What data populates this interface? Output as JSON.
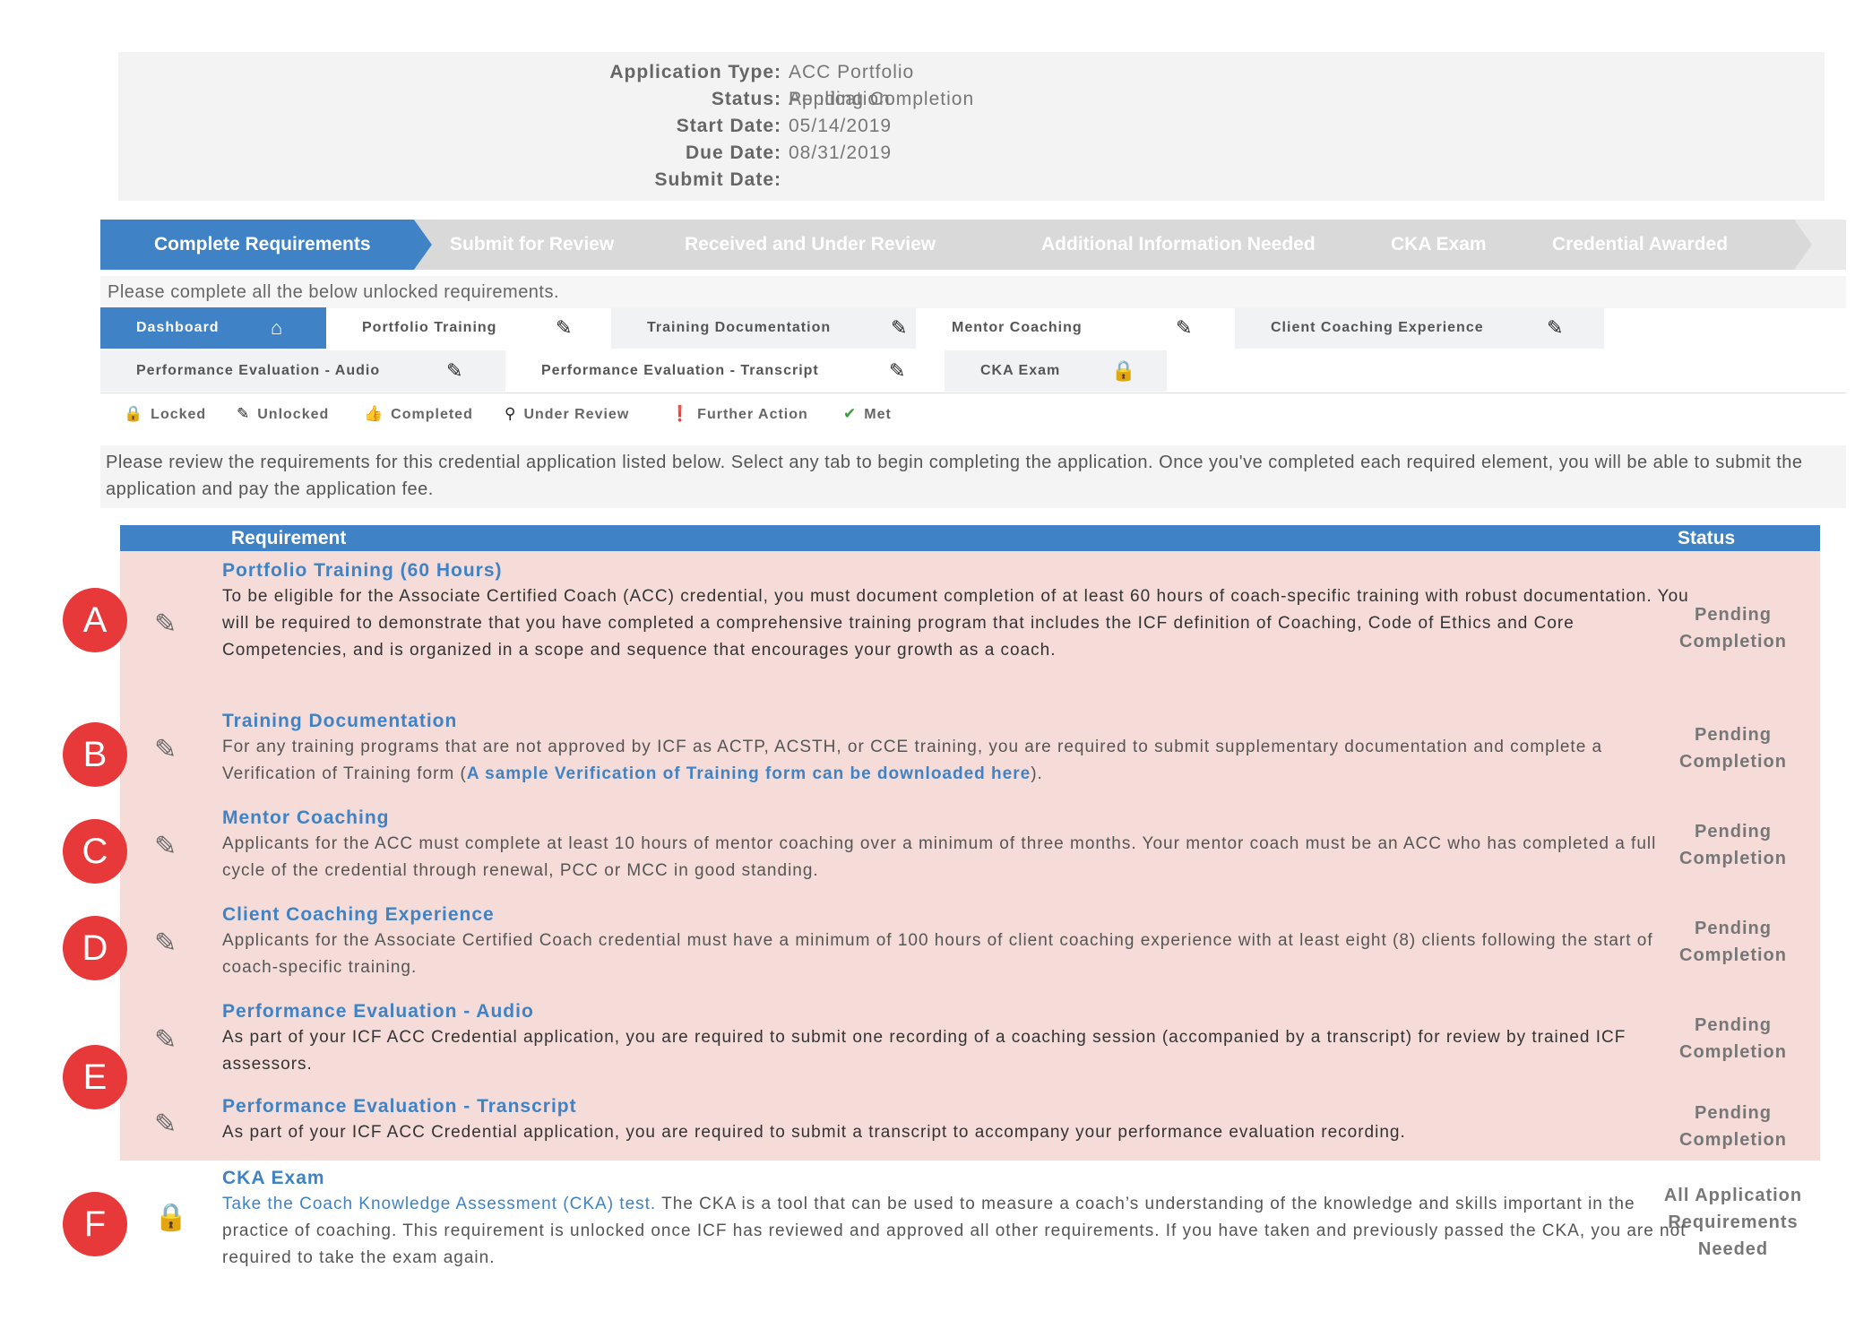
{
  "info": {
    "rows": [
      {
        "label": "Application Type:",
        "value": "ACC Portfolio Application"
      },
      {
        "label": "Status:",
        "value": "Pending Completion"
      },
      {
        "label": "Start Date:",
        "value": "05/14/2019"
      },
      {
        "label": "Due Date:",
        "value": "08/31/2019"
      },
      {
        "label": "Submit Date:",
        "value": ""
      }
    ]
  },
  "progress": {
    "steps": [
      "Complete Requirements",
      "Submit for Review",
      "Received and Under Review",
      "Additional Information Needed",
      "CKA Exam",
      "Credential Awarded"
    ],
    "note": "Please complete all the below unlocked requirements."
  },
  "tabs": [
    {
      "label": "Dashboard",
      "icon": "home-icon"
    },
    {
      "label": "Portfolio Training",
      "icon": "pencil-icon"
    },
    {
      "label": "Training Documentation",
      "icon": "pencil-icon"
    },
    {
      "label": "Mentor Coaching",
      "icon": "pencil-icon"
    },
    {
      "label": "Client Coaching Experience",
      "icon": "pencil-icon"
    },
    {
      "label": "Performance Evaluation - Audio",
      "icon": "pencil-icon"
    },
    {
      "label": "Performance Evaluation - Transcript",
      "icon": "pencil-icon"
    },
    {
      "label": "CKA Exam",
      "icon": "lock-icon"
    }
  ],
  "legend": [
    {
      "label": "Locked",
      "icon": "lock-icon"
    },
    {
      "label": "Unlocked",
      "icon": "pencil-icon"
    },
    {
      "label": "Completed",
      "icon": "thumbs-up-icon"
    },
    {
      "label": "Under Review",
      "icon": "search-icon"
    },
    {
      "label": "Further Action",
      "icon": "alert-icon"
    },
    {
      "label": "Met",
      "icon": "check-icon"
    }
  ],
  "colors": {
    "accent": "#3f82c5",
    "pending_row": "#f5dcd8",
    "marker": "#e8393a",
    "alert": "#e53935",
    "met": "#3a9b3a"
  },
  "instructions": "Please review the requirements for this credential application listed below. Select any tab to begin completing the application. Once you've completed each required element, you will be able to submit the application and pay the application fee.",
  "table": {
    "headers": {
      "requirement": "Requirement",
      "status": "Status"
    },
    "rows": [
      {
        "title": "Portfolio Training (60 Hours)",
        "description": "To be eligible for the Associate Certified Coach (ACC) credential, you must document completion of at least 60 hours of coach-specific training with robust documentation. You will be required to demonstrate that you have completed a comprehensive training program that includes the ICF definition of Coaching, Code of Ethics and Core Competencies, and is organized in a scope and sequence that encourages your growth as a coach.",
        "status": [
          "Pending",
          "Completion"
        ],
        "icon": "pencil-icon"
      },
      {
        "title": "Training Documentation",
        "description": "For any training programs that are not approved by ICF as ACTP, ACSTH, or CCE training, you are required to submit supplementary documentation and complete a Verification of Training form (",
        "link": "A sample Verification of Training form can be downloaded here",
        "after": ").",
        "status": [
          "Pending",
          "Completion"
        ],
        "icon": "pencil-icon"
      },
      {
        "title": "Mentor Coaching",
        "description": "Applicants for the ACC must complete at least 10 hours of mentor coaching over a minimum of three months. Your mentor coach must be an ACC who has completed a full cycle of the credential through renewal, PCC or MCC in good standing.",
        "status": [
          "Pending",
          "Completion"
        ],
        "icon": "pencil-icon"
      },
      {
        "title": "Client Coaching Experience",
        "description": "Applicants for the Associate Certified Coach credential must have a minimum of 100 hours of client coaching experience with at least eight (8) clients following the start of coach-specific training.",
        "status": [
          "Pending",
          "Completion"
        ],
        "icon": "pencil-icon"
      },
      {
        "title": "Performance Evaluation - Audio",
        "description": "As part of your ICF ACC Credential application, you are required to submit one recording of a coaching session (accompanied by a transcript) for review by trained ICF assessors.",
        "status": [
          "Pending",
          "Completion"
        ],
        "icon": "pencil-icon"
      },
      {
        "title": "Performance Evaluation - Transcript",
        "description": "As part of your ICF ACC Credential application, you are required to submit a transcript to accompany your performance evaluation recording.",
        "status": [
          "Pending",
          "Completion"
        ],
        "icon": "pencil-icon"
      },
      {
        "title": "CKA Exam",
        "link": "Take the Coach Knowledge Assessment (CKA) test.",
        "description": " The CKA is a tool that can be used to measure a coach’s understanding of the knowledge and skills important in the practice of coaching. This requirement is unlocked once ICF has reviewed and approved all other requirements. If you have taken and previously passed the CKA, you are not required to take the exam again.",
        "status": [
          "All Application",
          "Requirements",
          "Needed"
        ],
        "icon": "lock-icon"
      }
    ]
  },
  "markers": [
    "A",
    "B",
    "C",
    "D",
    "E",
    "F"
  ]
}
